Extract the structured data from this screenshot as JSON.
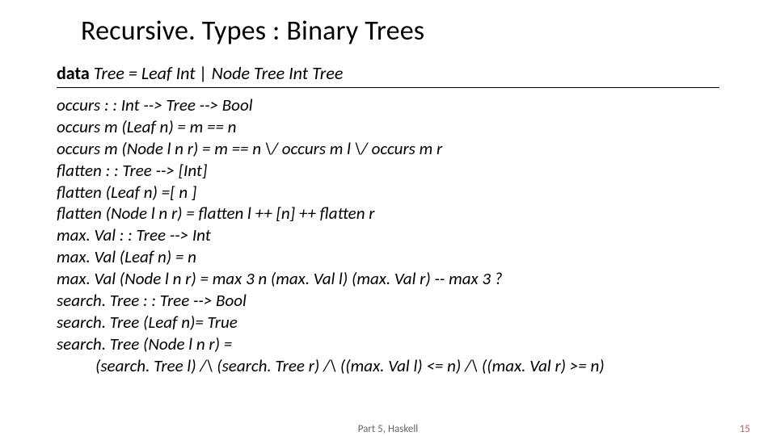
{
  "title": "Recursive. Types : Binary Trees",
  "decl_kw": "data",
  "decl_rest": "  Tree    =   Leaf  Int | Node Tree Int Tree",
  "lines": {
    "l1": "occurs   : : Int  -->  Tree  -->   Bool",
    "l2": "occurs m (Leaf n)     =      m == n",
    "l3": "occurs m (Node l n r)  =  m == n  \\/  occurs m l  \\/  occurs m r",
    "l4": "flatten   : : Tree  -->  [Int]",
    "l5": "flatten (Leaf n) =[ n ]",
    "l6": "flatten (Node l n r)  =      flatten l  ++ [n] ++ flatten r",
    "l7": "max. Val  : : Tree  -->  Int",
    "l8": "max. Val (Leaf n)  =   n",
    "l9": "max. Val (Node l n r)     =   max 3 n (max. Val l) (max. Val r)     -- max 3 ?",
    "l10": "search. Tree   : :   Tree  -->  Bool",
    "l11": "search. Tree (Leaf n)=     True",
    "l12": "search. Tree (Node l n r)  =",
    "l13": "(search. Tree l) /\\ (search. Tree r) /\\ ((max. Val l) <= n) /\\ ((max. Val r) >= n)"
  },
  "footer_center": "Part 5, Haskell",
  "footer_right": "15"
}
